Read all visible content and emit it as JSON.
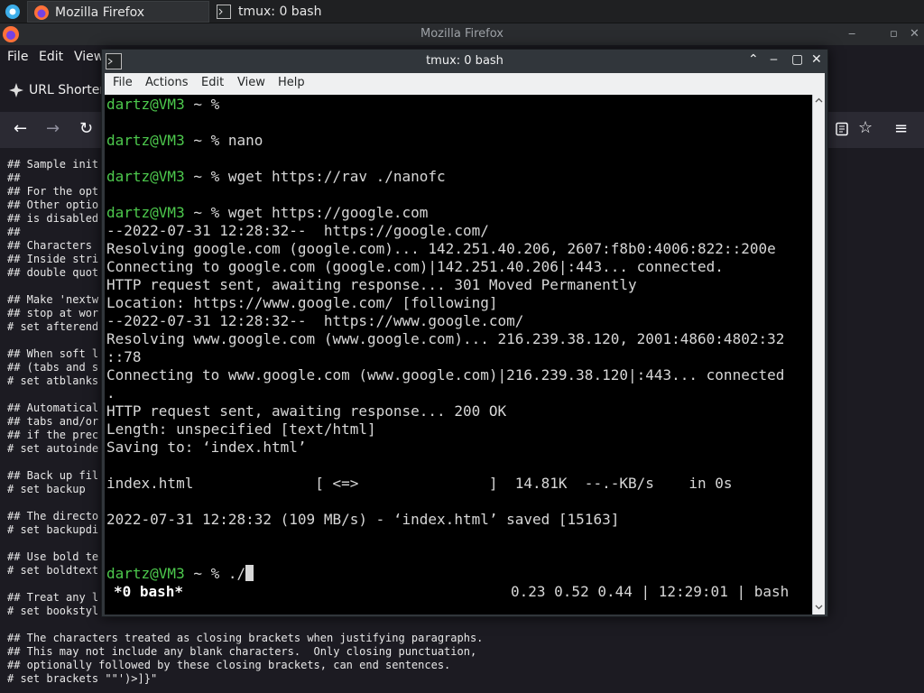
{
  "taskbar": {
    "firefox_task": "Mozilla Firefox",
    "tmux_task": "tmux: 0 bash"
  },
  "firefox": {
    "title": "Mozilla Firefox",
    "menu": [
      "File",
      "Edit",
      "View"
    ],
    "tab_label": "URL Shorter",
    "content_lines": [
      "## Sample init",
      "##",
      "## For the opt",
      "## Other optio",
      "## is disabled",
      "##",
      "## Characters",
      "## Inside stri",
      "## double quot",
      "",
      "## Make 'nextw",
      "## stop at wor",
      "# set afterend",
      "",
      "## When soft l",
      "## (tabs and s",
      "# set atblanks",
      "",
      "## Automatical",
      "## tabs and/or",
      "## if the prec",
      "# set autoinde",
      "",
      "## Back up fil",
      "# set backup",
      "",
      "## The directo",
      "# set backupdi",
      "",
      "## Use bold te",
      "# set boldtext",
      "",
      "## Treat any l",
      "# set bookstyl",
      "",
      "## The characters treated as closing brackets when justifying paragraphs.",
      "## This may not include any blank characters.  Only closing punctuation,",
      "## optionally followed by these closing brackets, can end sentences.",
      "# set brackets \"\"')>]}\""
    ],
    "icons": [
      "back-icon",
      "forward-icon",
      "reload-icon",
      "reader-view-icon",
      "bookmark-star-icon",
      "hamburger-menu-icon"
    ]
  },
  "konsole": {
    "title": "tmux: 0 bash",
    "menu": [
      "File",
      "Actions",
      "Edit",
      "View",
      "Help"
    ],
    "lines": [
      {
        "prompt": "dartz@VM3",
        "text": " ~ % "
      },
      {
        "prompt": "",
        "text": ""
      },
      {
        "prompt": "dartz@VM3",
        "text": " ~ % nano"
      },
      {
        "prompt": "",
        "text": ""
      },
      {
        "prompt": "dartz@VM3",
        "text": " ~ % wget https://rav ./nanofc"
      },
      {
        "prompt": "",
        "text": ""
      },
      {
        "prompt": "dartz@VM3",
        "text": " ~ % wget https://google.com"
      },
      {
        "prompt": "",
        "text": "--2022-07-31 12:28:32--  https://google.com/"
      },
      {
        "prompt": "",
        "text": "Resolving google.com (google.com)... 142.251.40.206, 2607:f8b0:4006:822::200e"
      },
      {
        "prompt": "",
        "text": "Connecting to google.com (google.com)|142.251.40.206|:443... connected."
      },
      {
        "prompt": "",
        "text": "HTTP request sent, awaiting response... 301 Moved Permanently"
      },
      {
        "prompt": "",
        "text": "Location: https://www.google.com/ [following]"
      },
      {
        "prompt": "",
        "text": "--2022-07-31 12:28:32--  https://www.google.com/"
      },
      {
        "prompt": "",
        "text": "Resolving www.google.com (www.google.com)... 216.239.38.120, 2001:4860:4802:32"
      },
      {
        "prompt": "",
        "text": "::78"
      },
      {
        "prompt": "",
        "text": "Connecting to www.google.com (www.google.com)|216.239.38.120|:443... connected"
      },
      {
        "prompt": "",
        "text": "."
      },
      {
        "prompt": "",
        "text": "HTTP request sent, awaiting response... 200 OK"
      },
      {
        "prompt": "",
        "text": "Length: unspecified [text/html]"
      },
      {
        "prompt": "",
        "text": "Saving to: ‘index.html’"
      },
      {
        "prompt": "",
        "text": ""
      },
      {
        "prompt": "",
        "text": "index.html              [ <=>               ]  14.81K  --.-KB/s    in 0s"
      },
      {
        "prompt": "",
        "text": ""
      },
      {
        "prompt": "",
        "text": "2022-07-31 12:28:32 (109 MB/s) - ‘index.html’ saved [15163]"
      },
      {
        "prompt": "",
        "text": ""
      },
      {
        "prompt": "",
        "text": ""
      },
      {
        "prompt": "dartz@VM3",
        "text": " ~ % ./"
      }
    ],
    "status_left": "*0 bash*",
    "status_right": "0.23 0.52 0.44 | 12:29:01 | bash"
  },
  "colors": {
    "prompt": "#4dc94d",
    "terminal_bg": "#000000",
    "terminal_fg": "#d7d7d7"
  }
}
